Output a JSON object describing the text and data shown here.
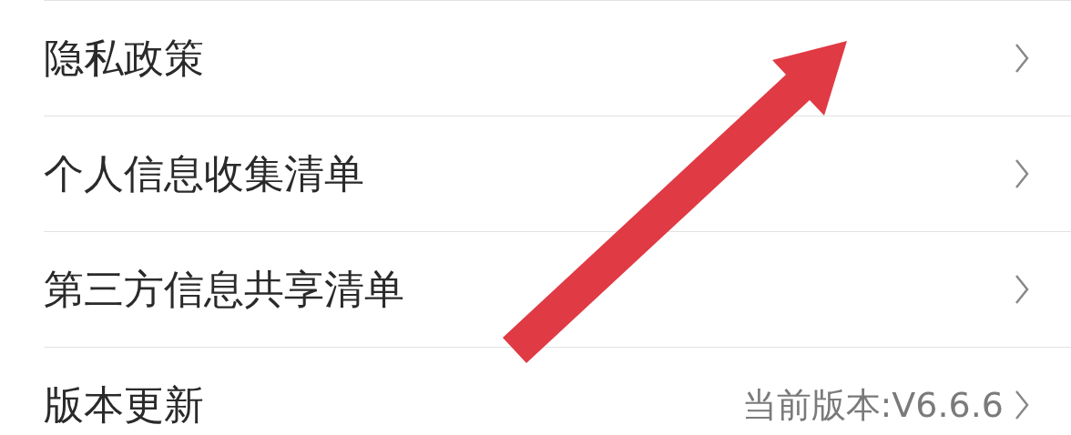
{
  "settings_items": [
    {
      "title": "隐私政策"
    },
    {
      "title": "个人信息收集清单"
    },
    {
      "title": "第三方信息共享清单"
    },
    {
      "title": "版本更新",
      "value": "当前版本:V6.6.6"
    }
  ]
}
